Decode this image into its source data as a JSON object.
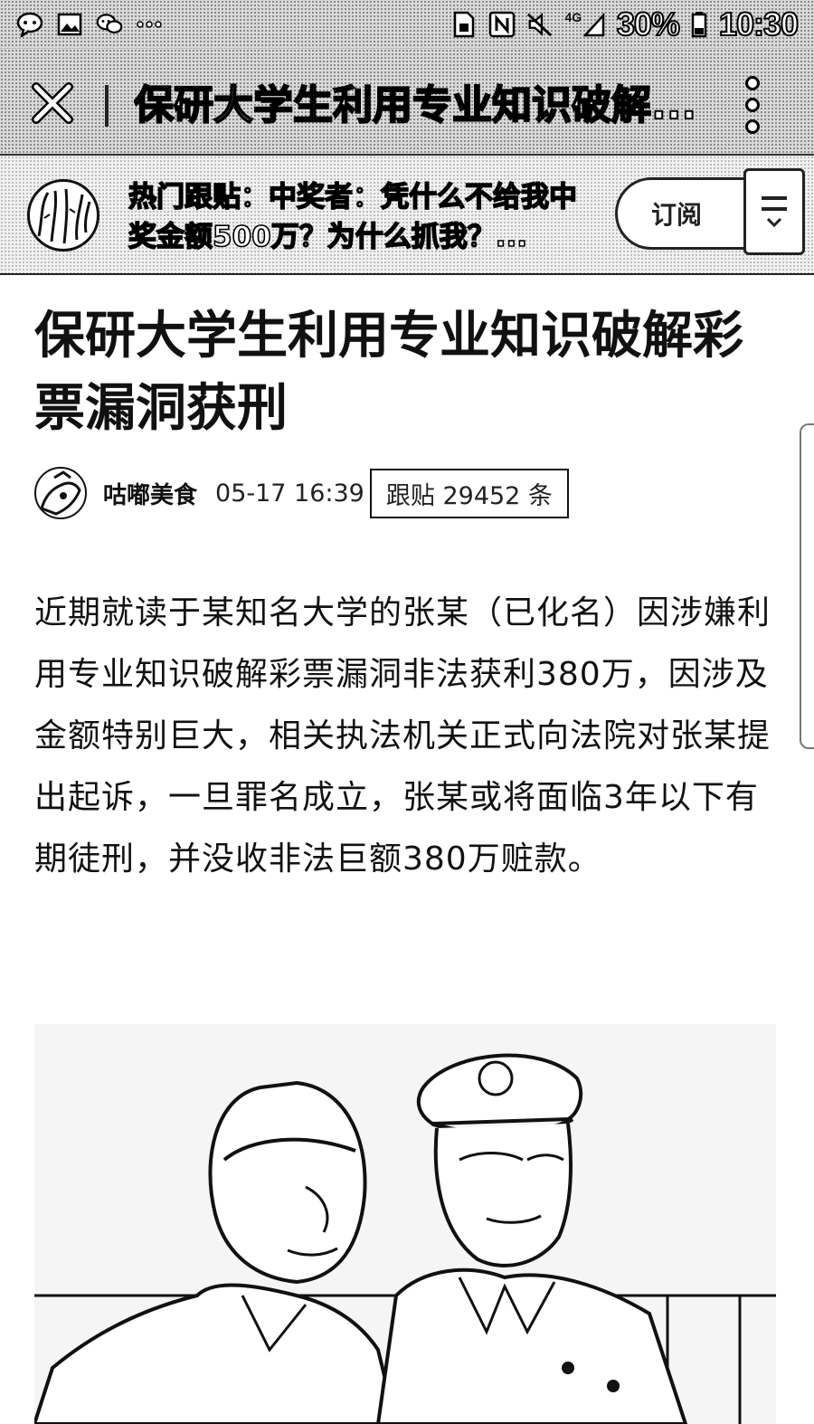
{
  "status_bar": {
    "network": "4G",
    "battery": "30%",
    "time": "10:30"
  },
  "title_bar": {
    "title": "保研大学生利用专业知识破解..."
  },
  "hot_comment": {
    "text": "热门跟贴：中奖者：凭什么不给我中奖金额500万？为什么抓我？...",
    "subscribe_label": "订阅"
  },
  "article": {
    "title": "保研大学生利用专业知识破解彩票漏洞获刑",
    "author": "咕嘟美食",
    "time": "05-17 16:39",
    "comment_count": "跟贴 29452 条",
    "body": "近期就读于某知名大学的张某（已化名）因涉嫌利用专业知识破解彩票漏洞非法获利380万，因涉及金额特别巨大，相关执法机关正式向法院对张某提出起诉，一旦罪名成立，张某或将面临3年以下有期徒刑，并没收非法巨额380万赃款。"
  }
}
